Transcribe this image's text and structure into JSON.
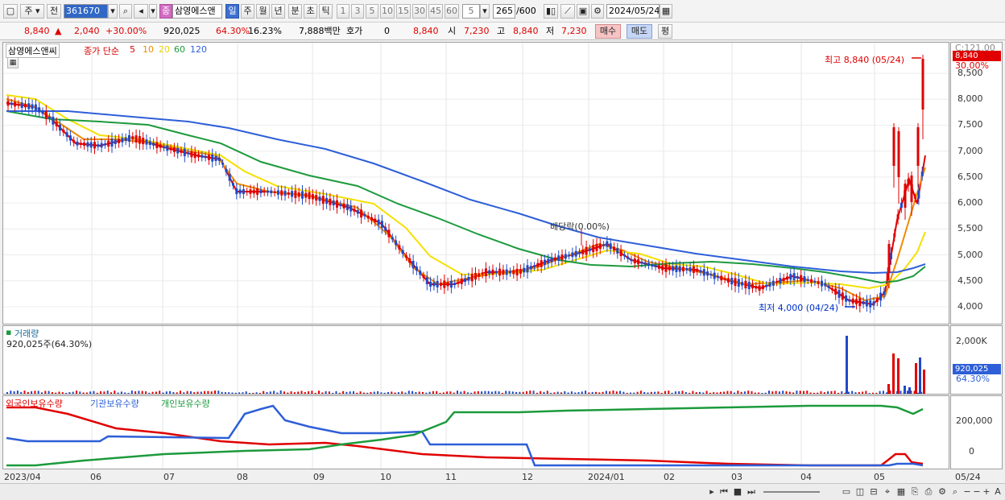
{
  "toolbar": {
    "period_type": "주",
    "prev_label": "전",
    "stock_code": "361670",
    "stock_badge": "종",
    "stock_name": "삼영에스앤",
    "timeframes": [
      "일",
      "주",
      "월",
      "년",
      "분",
      "초",
      "틱"
    ],
    "active_timeframe": "일",
    "intervals": [
      "1",
      "3",
      "5",
      "10",
      "15",
      "30",
      "45",
      "60"
    ],
    "custom_interval": "5",
    "count": "265",
    "count_total": "/600",
    "date": "2024/05/24"
  },
  "quote": {
    "price": "8,840",
    "change": "2,040",
    "change_pct": "+30.00%",
    "volume": "920,025",
    "volume_ratio": "64.30%",
    "turnover": "16.23%",
    "amount": "7,888백만",
    "hoga_label": "호가",
    "hoga_value": "0",
    "hoga_price": "8,840",
    "open_label": "시",
    "open": "7,230",
    "high_label": "고",
    "high": "8,840",
    "low_label": "저",
    "low": "7,230",
    "buy_label": "매수",
    "sell_label": "매도",
    "avg_label": "평"
  },
  "price_panel": {
    "name": "삼영에스앤씨",
    "ma_title": "종가 단순",
    "ma_periods": [
      "5",
      "10",
      "20",
      "60",
      "120"
    ],
    "ma_colors": [
      "#e00000",
      "#f08a00",
      "#f5e000",
      "#1c9a3c",
      "#2e5fd8"
    ],
    "axis_top": "C:121.00",
    "current_tag": "8,840",
    "current_pct": "30.00%",
    "ticks": [
      "8,500",
      "8,000",
      "7,500",
      "7,000",
      "6,500",
      "6,000",
      "5,500",
      "5,000",
      "4,500",
      "4,000"
    ],
    "high_note": "최고 8,840 (05/24)",
    "low_note": "최저 4,000 (04/24)",
    "dividend_note": "배당락(0.00%)"
  },
  "volume_panel": {
    "title": "거래량",
    "value_note": "920,025주(64.30%)",
    "ticks": [
      "2,000K"
    ],
    "current_tag": "920,025",
    "current_pct": "64.30%"
  },
  "holdings_panel": {
    "series": [
      "외국인보유수량",
      "기관보유수량",
      "개인보유수량"
    ],
    "colors": [
      "#e00000",
      "#2e5fd8",
      "#1c9a3c"
    ],
    "ticks": [
      "200,000",
      "0"
    ]
  },
  "x_axis": [
    "2023/04",
    "06",
    "07",
    "08",
    "09",
    "10",
    "11",
    "12",
    "2024/01",
    "02",
    "03",
    "04",
    "05",
    "05/24"
  ]
}
